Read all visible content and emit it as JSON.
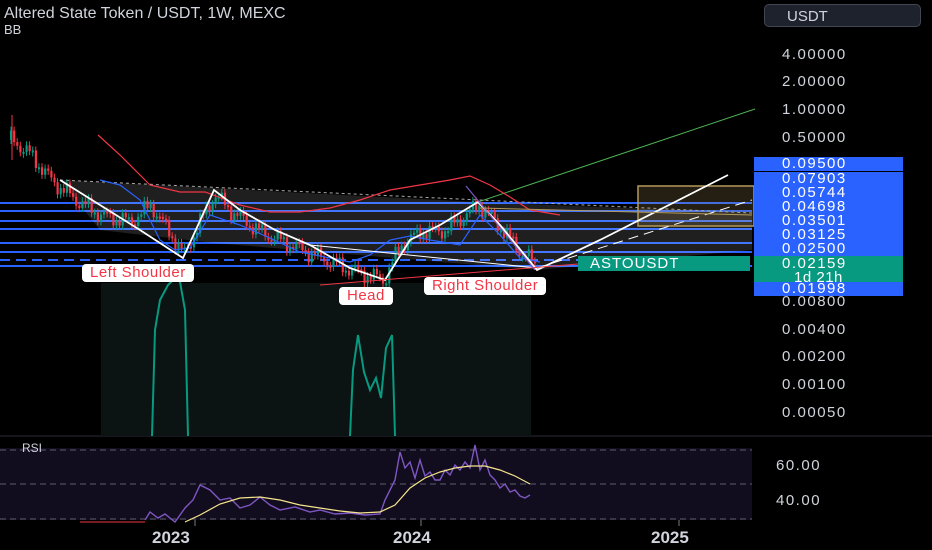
{
  "header": {
    "title": "Altered State Token / USDT, 1W, MEXC",
    "indicator": "BB",
    "currency_button": "USDT"
  },
  "price_axis": [
    "4.00000",
    "2.00000",
    "1.00000",
    "0.50000",
    "0.00800",
    "0.00400",
    "0.00200",
    "0.00100",
    "0.00050"
  ],
  "highlight_levels": [
    "0.09500",
    "0.07903",
    "0.05744",
    "0.04698",
    "0.03501",
    "0.03125",
    "0.02500"
  ],
  "current_price": {
    "symbol": "ASTOUSDT",
    "price": "0.02159",
    "countdown": "1d 21h"
  },
  "low_level": "0.01998",
  "pattern_labels": {
    "left_shoulder": "Left Shoulder",
    "head": "Head",
    "right_shoulder": "Right Shoulder"
  },
  "rsi": {
    "label": "RSI",
    "axis": [
      "60.00",
      "40.00"
    ]
  },
  "time_axis": [
    "2023",
    "2024",
    "2025"
  ],
  "colors": {
    "up": "#089981",
    "down": "#f23645",
    "level": "#2962ff",
    "bb_upper": "#f23645",
    "bb_lower": "#2962ff",
    "rsi": "#7e57c2",
    "rsi_ma": "#f5e58d",
    "target_zone": "#b39a5a"
  }
}
